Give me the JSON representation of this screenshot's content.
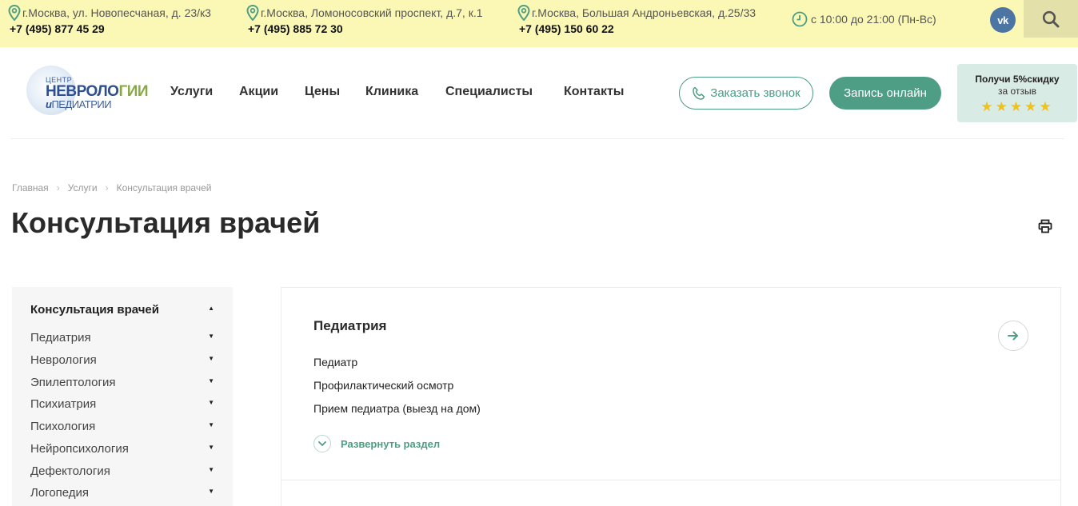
{
  "topbar": {
    "addresses": [
      {
        "address": "г.Москва, ул. Новопесчаная, д. 23/к3",
        "phone": "+7 (495) 877 45 29"
      },
      {
        "address": "г.Москва, Ломоносовский проспект, д.7, к.1",
        "phone": "+7 (495) 885 72 30"
      },
      {
        "address": "г.Москва, Большая Андроньевская, д.25/33",
        "phone": "+7 (495) 150 60 22"
      }
    ],
    "hours": "с 10:00 до 21:00 (Пн-Вс)",
    "vk_label": "vk",
    "icons": {
      "location": "location-pin-icon",
      "clock": "clock-icon",
      "search": "search-icon"
    },
    "accent_color": "#4e9e86",
    "bar_color": "#fbf7b5"
  },
  "logo": {
    "small": "ЦЕНТР",
    "big_1": "НЕВРОЛО",
    "big_2": "ГИИ",
    "sub_i": "и",
    "sub": "ПЕДИАТРИИ"
  },
  "nav": {
    "items": [
      "Услуги",
      "Акции",
      "Цены",
      "Клиника",
      "Специалисты",
      "Контакты"
    ]
  },
  "header": {
    "call_button": "Заказать звонок",
    "online_button": "Запись онлайн",
    "promo_title": "Получи 5%скидку",
    "promo_sub": "за отзыв",
    "promo_stars": "★★★★★"
  },
  "breadcrumb": [
    "Главная",
    "Услуги",
    "Консультация врачей"
  ],
  "page_title": "Консультация врачей",
  "sidebar": {
    "heading": "Консультация врачей",
    "items": [
      "Педиатрия",
      "Неврология",
      "Эпилептология",
      "Психиатрия",
      "Психология",
      "Нейропсихология",
      "Дефектология",
      "Логопедия"
    ]
  },
  "section": {
    "title": "Педиатрия",
    "links": [
      "Педиатр",
      "Профилактический осмотр",
      "Прием педиатра (выезд на дом)"
    ],
    "expand_label": "Развернуть раздел"
  }
}
